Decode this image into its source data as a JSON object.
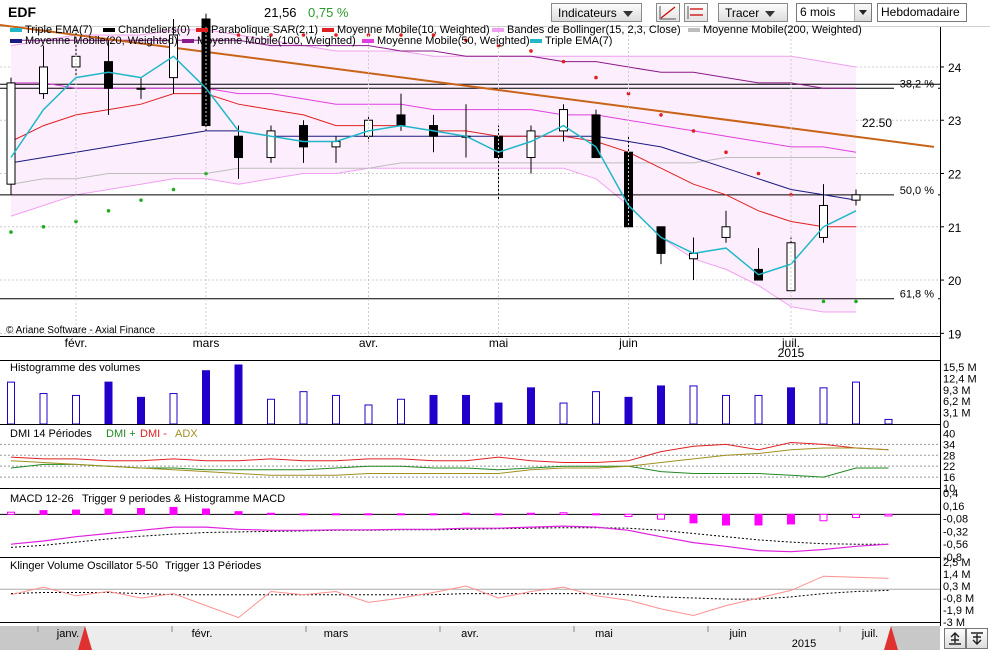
{
  "toolbar": {
    "ticker": "EDF",
    "price": "21,56",
    "change": "0,75 %",
    "indicators_label": "Indicateurs",
    "draw_label": "Tracer",
    "period_value": "6 mois",
    "frequency_value": "Hebdomadaire"
  },
  "colors": {
    "up": "#ffffff",
    "down": "#000000",
    "sar": "#e02020",
    "sar_below": "#22aa22",
    "ma10": "#e02020",
    "ma20": "#1a1a80",
    "ma50": "#e040e0",
    "ma100": "#8a1a8a",
    "ma200": "#bdbdbd",
    "bollinger": "#f0a0f0",
    "bollinger_fill": "#fdeefd",
    "triple_ema": "#20b8c8",
    "trend": "#c86418",
    "volume_down": "#2200cc",
    "dmi_plus": "#228822",
    "dmi_minus": "#e02020",
    "adx": "#a09020",
    "macd": "#e020e0",
    "macd_hist": "#ff00ff",
    "klinger": "#ff9090"
  },
  "chart_data": [
    {
      "type": "candlestick",
      "legend": [
        "Triple EMA(7)",
        "Chandeliers(0)",
        "Parabolique SAR(2,1)",
        "Moyenne Mobile(10, Weighted)",
        "Bandes de Bollinger(15, 2,3, Close)",
        "Moyenne Mobile(200, Weighted)",
        "Moyenne Mobile(20, Weighted)",
        "Moyenne Mobile(100, Weighted)",
        "Moyenne Mobile(50, Weighted)",
        "Triple EMA(7)"
      ],
      "copyright": "© Ariane Software - Axial Finance",
      "yticks": [
        "24",
        "23",
        "22",
        "21",
        "20",
        "19"
      ],
      "ylim": [
        18.95,
        24.75
      ],
      "xticks": [
        "févr.",
        "mars",
        "avr.",
        "mai",
        "juin",
        "juil."
      ],
      "xtick_index": [
        2,
        6,
        11,
        15,
        19,
        24
      ],
      "year_label": "2015",
      "year_index": 24,
      "levels": [
        {
          "label": "38,2 %",
          "value": 23.6
        },
        {
          "label": "50,0 %",
          "value": 21.6
        },
        {
          "label": "61,8 %",
          "value": 19.65
        }
      ],
      "annotation": {
        "label": "22.50",
        "value": 22.95
      },
      "candles": [
        {
          "o": 21.8,
          "h": 23.8,
          "l": 21.6,
          "c": 23.7
        },
        {
          "o": 23.5,
          "h": 24.4,
          "l": 23.4,
          "c": 24.0
        },
        {
          "o": 24.0,
          "h": 24.7,
          "l": 23.8,
          "c": 24.2
        },
        {
          "o": 24.1,
          "h": 24.5,
          "l": 23.1,
          "c": 23.6
        },
        {
          "o": 23.6,
          "h": 23.8,
          "l": 23.4,
          "c": 23.6
        },
        {
          "o": 23.8,
          "h": 24.9,
          "l": 23.5,
          "c": 24.6
        },
        {
          "o": 24.9,
          "h": 25.0,
          "l": 22.8,
          "c": 22.9
        },
        {
          "o": 22.7,
          "h": 22.9,
          "l": 21.9,
          "c": 22.3
        },
        {
          "o": 22.3,
          "h": 22.9,
          "l": 22.2,
          "c": 22.8
        },
        {
          "o": 22.9,
          "h": 23.0,
          "l": 22.2,
          "c": 22.5
        },
        {
          "o": 22.5,
          "h": 22.7,
          "l": 22.2,
          "c": 22.6
        },
        {
          "o": 22.7,
          "h": 23.1,
          "l": 22.6,
          "c": 23.0
        },
        {
          "o": 23.1,
          "h": 23.5,
          "l": 22.8,
          "c": 22.9
        },
        {
          "o": 22.9,
          "h": 23.1,
          "l": 22.4,
          "c": 22.7
        },
        {
          "o": 22.7,
          "h": 23.3,
          "l": 22.3,
          "c": 22.7
        },
        {
          "o": 22.7,
          "h": 22.9,
          "l": 21.5,
          "c": 22.3
        },
        {
          "o": 22.3,
          "h": 22.9,
          "l": 22.0,
          "c": 22.8
        },
        {
          "o": 22.8,
          "h": 23.3,
          "l": 22.6,
          "c": 23.2
        },
        {
          "o": 23.1,
          "h": 23.2,
          "l": 22.3,
          "c": 22.3
        },
        {
          "o": 22.4,
          "h": 22.7,
          "l": 21.0,
          "c": 21.0
        },
        {
          "o": 21.0,
          "h": 21.0,
          "l": 20.3,
          "c": 20.5
        },
        {
          "o": 20.4,
          "h": 20.8,
          "l": 20.0,
          "c": 20.5
        },
        {
          "o": 20.8,
          "h": 21.3,
          "l": 20.7,
          "c": 21.0
        },
        {
          "o": 20.2,
          "h": 20.6,
          "l": 20.0,
          "c": 20.0
        },
        {
          "o": 19.8,
          "h": 20.8,
          "l": 19.8,
          "c": 20.7
        },
        {
          "o": 20.8,
          "h": 21.8,
          "l": 20.7,
          "c": 21.4
        },
        {
          "o": 21.5,
          "h": 21.7,
          "l": 21.4,
          "c": 21.6
        }
      ],
      "sar": [
        {
          "v": 20.9,
          "below": true
        },
        {
          "v": 21.0,
          "below": true
        },
        {
          "v": 21.1,
          "below": true
        },
        {
          "v": 21.3,
          "below": true
        },
        {
          "v": 21.5,
          "below": true
        },
        {
          "v": 21.7,
          "below": true
        },
        {
          "v": 22.0,
          "below": true
        },
        {
          "v": 24.6,
          "below": false
        },
        {
          "v": 24.6,
          "below": false
        },
        {
          "v": 24.6,
          "below": false
        },
        {
          "v": 24.6,
          "below": false
        },
        {
          "v": 24.6,
          "below": false
        },
        {
          "v": 24.6,
          "below": false
        },
        {
          "v": 24.6,
          "below": false
        },
        {
          "v": 24.5,
          "below": false
        },
        {
          "v": 24.4,
          "below": false
        },
        {
          "v": 24.3,
          "below": false
        },
        {
          "v": 24.1,
          "below": false
        },
        {
          "v": 23.8,
          "below": false
        },
        {
          "v": 23.5,
          "below": false
        },
        {
          "v": 23.1,
          "below": false
        },
        {
          "v": 22.8,
          "below": false
        },
        {
          "v": 22.4,
          "below": false
        },
        {
          "v": 22.0,
          "below": false
        },
        {
          "v": 21.6,
          "below": false
        },
        {
          "v": 19.6,
          "below": true
        },
        {
          "v": 19.6,
          "below": true
        }
      ],
      "ma10": [
        22.6,
        22.9,
        23.1,
        23.2,
        23.3,
        23.5,
        23.5,
        23.3,
        23.2,
        23.1,
        22.9,
        22.9,
        22.9,
        22.8,
        22.8,
        22.7,
        22.7,
        22.7,
        22.6,
        22.4,
        22.1,
        21.8,
        21.6,
        21.3,
        21.1,
        21.0,
        21.0
      ],
      "ma20": [
        22.2,
        22.3,
        22.4,
        22.5,
        22.6,
        22.7,
        22.8,
        22.8,
        22.7,
        22.7,
        22.7,
        22.7,
        22.7,
        22.7,
        22.7,
        22.7,
        22.7,
        22.7,
        22.7,
        22.6,
        22.5,
        22.3,
        22.1,
        21.9,
        21.7,
        21.6,
        21.5
      ],
      "ma50": [
        23.7,
        23.7,
        23.6,
        23.6,
        23.6,
        23.6,
        23.6,
        23.5,
        23.5,
        23.4,
        23.3,
        23.3,
        23.3,
        23.2,
        23.2,
        23.2,
        23.2,
        23.1,
        23.1,
        23.0,
        22.9,
        22.8,
        22.7,
        22.6,
        22.5,
        22.5,
        22.4
      ],
      "ma100": [
        24.5,
        24.5,
        24.5,
        24.5,
        24.5,
        24.5,
        24.5,
        24.5,
        24.4,
        24.4,
        24.4,
        24.4,
        24.3,
        24.3,
        24.2,
        24.2,
        24.2,
        24.1,
        24.1,
        24.0,
        23.9,
        23.9,
        23.8,
        23.7,
        23.7,
        23.6,
        23.6
      ],
      "ma200": [
        21.8,
        21.9,
        21.9,
        22.0,
        22.0,
        22.0,
        22.0,
        22.1,
        22.1,
        22.1,
        22.1,
        22.1,
        22.2,
        22.2,
        22.2,
        22.2,
        22.2,
        22.2,
        22.2,
        22.2,
        22.2,
        22.2,
        22.3,
        22.3,
        22.3,
        22.3,
        22.3
      ],
      "tema": [
        22.3,
        23.2,
        23.8,
        23.9,
        23.8,
        24.2,
        23.6,
        22.8,
        22.7,
        22.6,
        22.6,
        22.8,
        22.9,
        22.8,
        22.7,
        22.4,
        22.6,
        22.9,
        22.5,
        21.4,
        20.8,
        20.5,
        20.6,
        20.1,
        20.3,
        21.0,
        21.3
      ],
      "boll_upper": [
        24.4,
        24.5,
        24.6,
        24.6,
        24.6,
        24.7,
        24.7,
        24.6,
        24.5,
        24.4,
        24.3,
        24.3,
        24.3,
        24.2,
        24.2,
        24.2,
        24.2,
        24.2,
        24.2,
        24.2,
        24.2,
        24.2,
        24.2,
        24.2,
        24.2,
        24.1,
        24.0
      ],
      "boll_lower": [
        21.2,
        21.4,
        21.6,
        21.7,
        21.8,
        21.9,
        21.9,
        21.8,
        21.9,
        22.0,
        22.0,
        22.1,
        22.1,
        22.1,
        22.1,
        22.1,
        22.1,
        22.1,
        21.9,
        21.4,
        20.8,
        20.4,
        20.2,
        19.9,
        19.5,
        19.4,
        19.4
      ],
      "trendline": {
        "from": {
          "i": -0.5,
          "v": 24.8
        },
        "to": {
          "i": 28.4,
          "v": 22.5
        }
      }
    },
    {
      "type": "bar",
      "title": "Histogramme des volumes",
      "yticks": [
        "15,5 M",
        "12,4 M",
        "9,3 M",
        "6,2 M",
        "3,1 M",
        "0"
      ],
      "ylim": [
        0,
        15.5
      ],
      "values": [
        11,
        8,
        7.5,
        11,
        7,
        8,
        14,
        15.5,
        6.5,
        8.5,
        7.5,
        5,
        6.5,
        7.5,
        7.5,
        5.5,
        9.5,
        5.5,
        8.5,
        7,
        10,
        10,
        7.5,
        7.5,
        9.5,
        9.5,
        11,
        1.2
      ],
      "down": [
        false,
        false,
        false,
        true,
        true,
        false,
        true,
        true,
        false,
        false,
        false,
        false,
        false,
        true,
        true,
        true,
        true,
        false,
        false,
        true,
        true,
        false,
        false,
        false,
        true,
        false,
        false,
        false
      ]
    },
    {
      "type": "line",
      "title": "DMI 14 Périodes",
      "series_labels": [
        "DMI +",
        "DMI -",
        "ADX"
      ],
      "yticks": [
        "40",
        "34",
        "28",
        "22",
        "16",
        "10"
      ],
      "ylim": [
        10,
        40
      ],
      "dmi_plus": [
        21,
        23,
        23,
        22,
        21,
        21,
        20,
        20,
        20,
        20,
        21,
        22,
        22,
        21,
        21,
        20,
        21,
        22,
        22,
        22,
        19,
        18,
        18,
        18,
        17,
        16,
        21,
        21
      ],
      "dmi_minus": [
        27,
        26,
        26,
        25,
        25,
        26,
        25,
        25,
        26,
        25,
        25,
        26,
        26,
        25,
        25,
        27,
        25,
        24,
        24,
        25,
        30,
        33,
        34,
        31,
        35,
        34,
        32,
        31
      ],
      "adx": [
        25,
        24,
        23,
        22,
        21,
        20,
        19,
        18,
        17,
        17,
        17,
        18,
        18,
        18,
        18,
        18,
        20,
        21,
        21,
        22,
        24,
        26,
        28,
        29,
        31,
        32,
        32,
        31
      ]
    },
    {
      "type": "line",
      "title": "MACD 12-26",
      "trigger_title": "Trigger 9 periodes & Histogramme MACD",
      "yticks": [
        "0,4",
        "0,16",
        "-0,08",
        "-0,32",
        "-0,56",
        "-0,8"
      ],
      "ylim": [
        -0.8,
        0.4
      ],
      "macd": [
        -0.56,
        -0.5,
        -0.42,
        -0.36,
        -0.3,
        -0.24,
        -0.24,
        -0.28,
        -0.3,
        -0.3,
        -0.29,
        -0.29,
        -0.28,
        -0.28,
        -0.26,
        -0.26,
        -0.24,
        -0.22,
        -0.24,
        -0.3,
        -0.42,
        -0.53,
        -0.6,
        -0.68,
        -0.7,
        -0.66,
        -0.6,
        -0.56
      ],
      "trigger": [
        -0.62,
        -0.58,
        -0.52,
        -0.46,
        -0.41,
        -0.37,
        -0.34,
        -0.33,
        -0.32,
        -0.31,
        -0.3,
        -0.3,
        -0.29,
        -0.29,
        -0.28,
        -0.27,
        -0.26,
        -0.25,
        -0.25,
        -0.26,
        -0.3,
        -0.36,
        -0.42,
        -0.48,
        -0.52,
        -0.55,
        -0.56,
        -0.56
      ],
      "hist": [
        0.04,
        0.07,
        0.08,
        0.1,
        0.11,
        0.13,
        0.1,
        0.05,
        0.02,
        0.01,
        0.01,
        0.01,
        0.01,
        0.01,
        0.02,
        0.01,
        0.02,
        0.03,
        0.01,
        -0.04,
        -0.09,
        -0.16,
        -0.2,
        -0.2,
        -0.18,
        -0.12,
        -0.06,
        -0.03
      ]
    },
    {
      "type": "line",
      "title": "Klinger Volume Oscillator 5-50",
      "trigger_title": "Trigger 13 Périodes",
      "yticks": [
        "2,5 M",
        "1,4 M",
        "0,3 M",
        "-0,8 M",
        "-1,9 M",
        "-3 M"
      ],
      "ylim": [
        -3,
        2.5
      ],
      "kvo": [
        -0.5,
        0.2,
        -0.6,
        -0.2,
        -0.8,
        -0.4,
        -1.5,
        -2.6,
        -0.2,
        -0.5,
        -0.2,
        -1.2,
        -0.8,
        -0.3,
        0.3,
        -0.8,
        -0.2,
        0.2,
        -0.6,
        -1.0,
        -1.8,
        -2.4,
        -1.5,
        -0.8,
        -0.1,
        1.2,
        1.1,
        1.0
      ],
      "trigger": [
        -0.4,
        -0.3,
        -0.3,
        -0.3,
        -0.4,
        -0.5,
        -0.5,
        -0.5,
        -0.5,
        -0.5,
        -0.5,
        -0.5,
        -0.5,
        -0.5,
        -0.4,
        -0.4,
        -0.4,
        -0.4,
        -0.4,
        -0.5,
        -0.7,
        -0.8,
        -0.9,
        -0.9,
        -0.7,
        -0.4,
        -0.2,
        -0.1
      ]
    },
    {
      "type": "timeline",
      "xticks": [
        "janv.",
        "févr.",
        "mars",
        "avr.",
        "mai",
        "juin",
        "juil."
      ],
      "year_label": "2015"
    }
  ]
}
